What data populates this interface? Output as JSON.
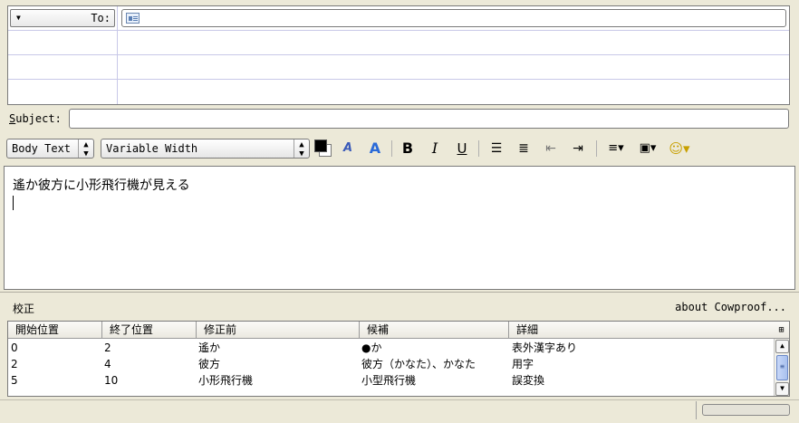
{
  "address": {
    "type_label": "To:",
    "rows": 4,
    "card_icon": "address-card-icon"
  },
  "subject": {
    "label_prefix": "S",
    "label_rest": "ubject:",
    "value": ""
  },
  "toolbar": {
    "paragraph_format": "Body Text",
    "font": "Variable Width",
    "bold": "B",
    "italic": "I",
    "underline": "U",
    "text_color": "#000000",
    "background_color": "#ffffff",
    "smaller_text": "A",
    "larger_text": "A"
  },
  "editor": {
    "body_line1": "遙か彼方に小形飛行機が見える"
  },
  "cowproof": {
    "title": "校正",
    "about": "about Cowproof...",
    "columns": [
      "開始位置",
      "終了位置",
      "修正前",
      "候補",
      "詳細"
    ],
    "rows": [
      [
        "0",
        "2",
        "遙か",
        "●か",
        "表外漢字あり"
      ],
      [
        "2",
        "4",
        "彼方",
        "彼方（かなた）、かなた",
        "用字"
      ],
      [
        "5",
        "10",
        "小形飛行機",
        "小型飛行機",
        "誤変換"
      ]
    ]
  }
}
